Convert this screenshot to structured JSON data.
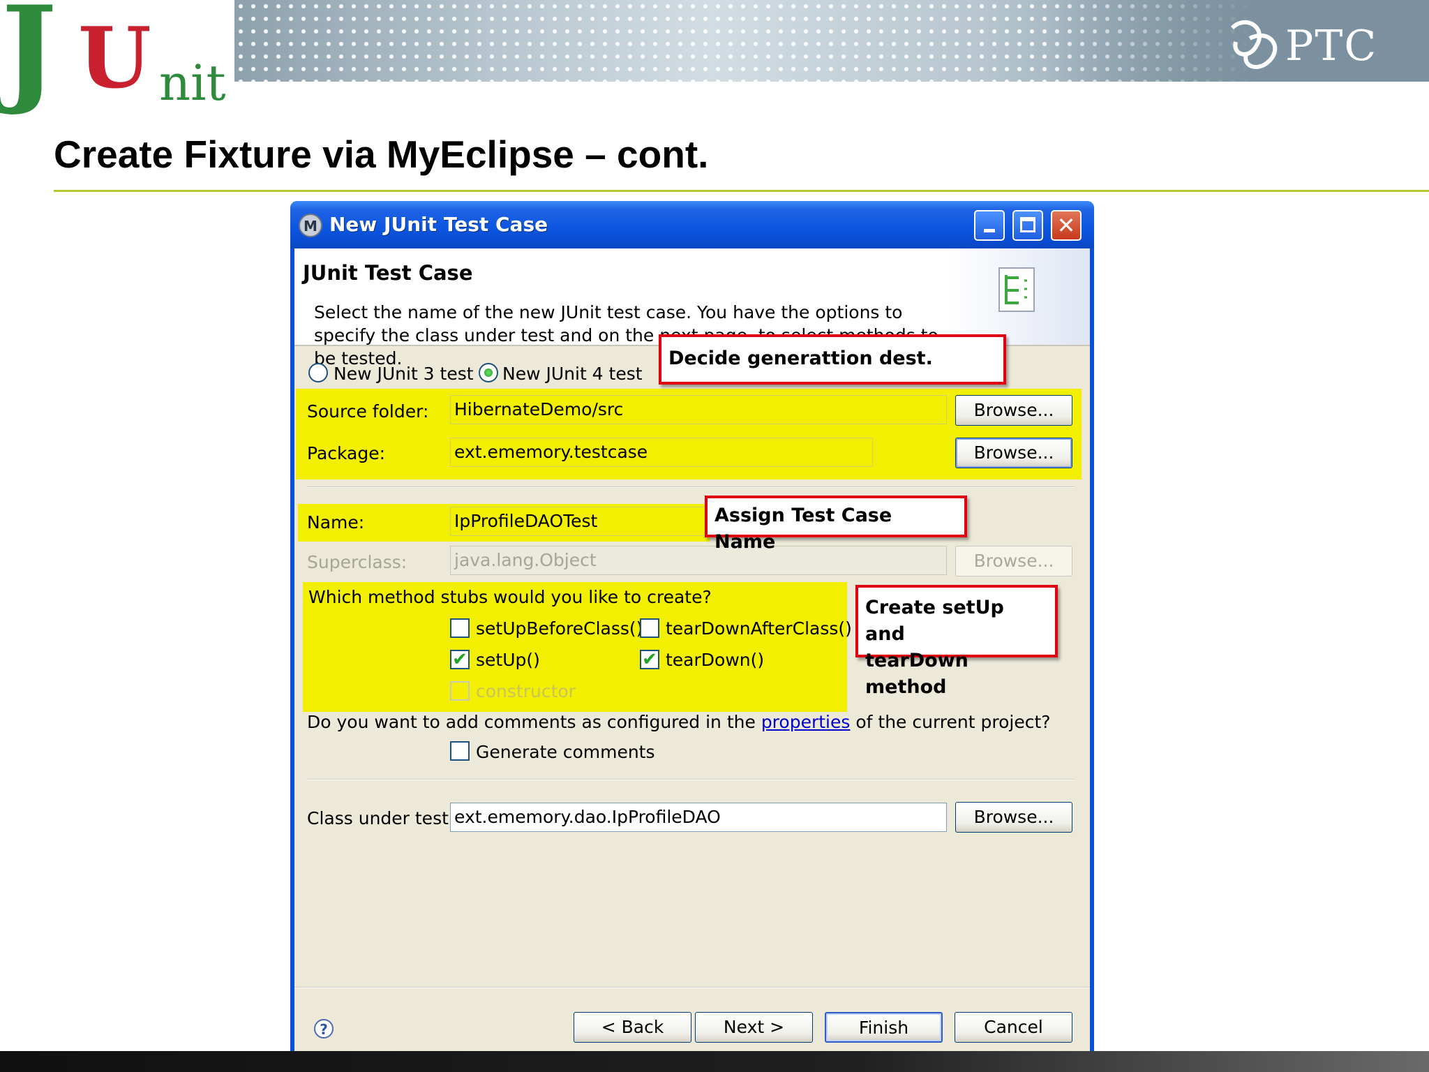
{
  "slide": {
    "title": "Create Fixture via MyEclipse – cont.",
    "logo_left": {
      "j": "J",
      "u": "U",
      "nit": "nit"
    },
    "logo_right": "PTC"
  },
  "dialog": {
    "title": "New JUnit Test Case",
    "window_buttons": {
      "minimize": "minimize-icon",
      "maximize": "maximize-icon",
      "close": "✕"
    },
    "heading": "JUnit Test Case",
    "description": "Select the name of the new JUnit test case. You have the options to specify the class under test and on the next page, to select methods to be tested.",
    "junit_version": {
      "option3": "New JUnit 3 test",
      "option4": "New JUnit 4 test",
      "selected": "option4"
    },
    "source_folder": {
      "label": "Source folder:",
      "value": "HibernateDemo/src",
      "browse": "Browse..."
    },
    "package": {
      "label": "Package:",
      "value": "ext.ememory.testcase",
      "browse": "Browse..."
    },
    "name": {
      "label": "Name:",
      "value": "IpProfileDAOTest"
    },
    "superclass": {
      "label": "Superclass:",
      "value": "java.lang.Object",
      "browse": "Browse..."
    },
    "stubs": {
      "question": "Which method stubs would you like to create?",
      "setUpBeforeClass": {
        "label": "setUpBeforeClass()",
        "checked": false
      },
      "tearDownAfterClass": {
        "label": "tearDownAfterClass()",
        "checked": false
      },
      "setUp": {
        "label": "setUp()",
        "checked": true
      },
      "tearDown": {
        "label": "tearDown()",
        "checked": true
      },
      "constructor": {
        "label": "constructor",
        "checked": false
      }
    },
    "comments": {
      "question_before": "Do you want to add comments as configured in the",
      "link": "properties",
      "question_after": "of the current project?",
      "checkbox": "Generate comments"
    },
    "class_under_test": {
      "label": "Class under test:",
      "value": "ext.ememory.dao.IpProfileDAO",
      "browse": "Browse..."
    },
    "footer": {
      "help": "?",
      "back": "< Back",
      "next": "Next >",
      "finish": "Finish",
      "cancel": "Cancel"
    },
    "check_mark": "✔"
  },
  "callouts": {
    "generation": "Decide generattion dest.",
    "name": "Assign Test Case Name",
    "setup": [
      "Create setUp and",
      "tearDown method"
    ]
  },
  "colors": {
    "highlight": "#f2ef00",
    "callout_border": "#e00012",
    "titlebar": "#0b55e0",
    "title_rule": "#b6c830"
  }
}
